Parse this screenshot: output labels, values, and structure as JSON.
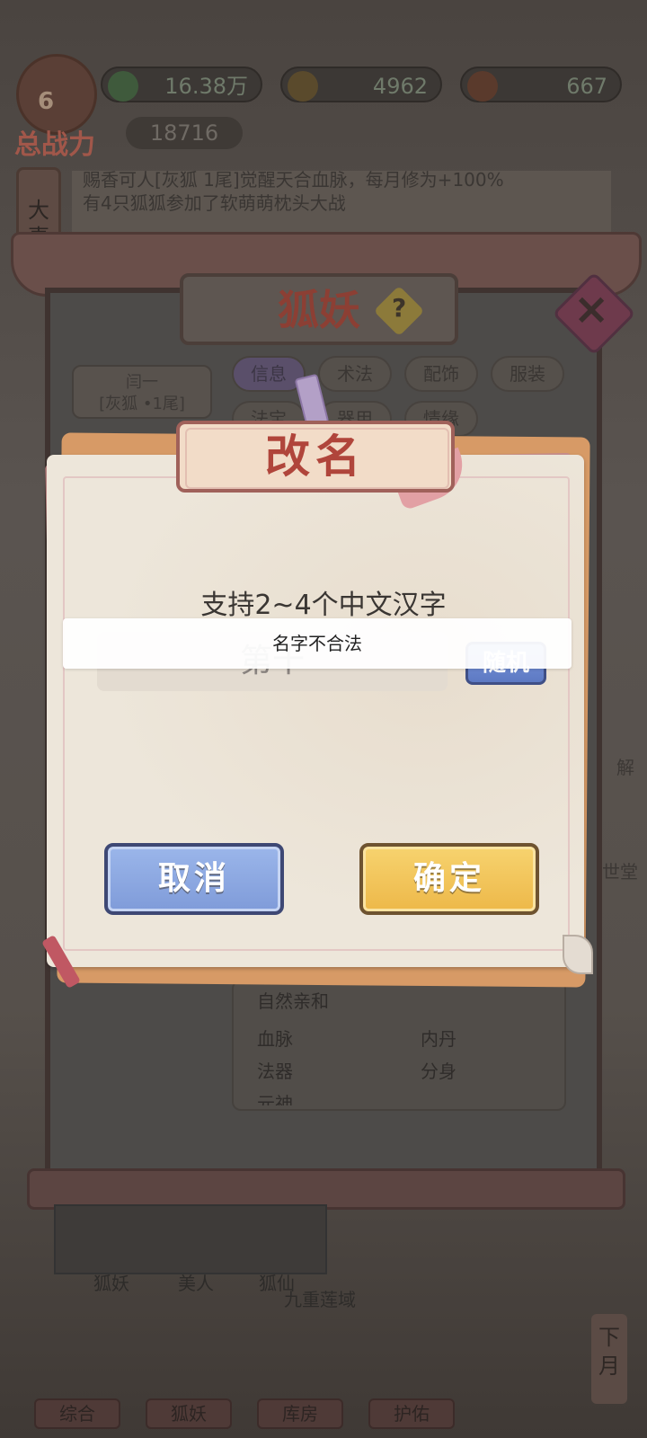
{
  "header": {
    "resources": [
      {
        "icon": "jade-gem-icon",
        "value": "16.38万",
        "color": "#4fa05a"
      },
      {
        "icon": "gold-coin-icon",
        "value": "4962",
        "color": "#d7a43a"
      },
      {
        "icon": "peach-icon",
        "value": "667",
        "color": "#d05a3a"
      }
    ],
    "power_label": "总战力",
    "power_level": "6",
    "power_value": "18716"
  },
  "events": {
    "label": "大事",
    "lines": [
      "赐香可人[灰狐 1尾]觉醒天合血脉，每月修为+100%",
      "有4只狐狐参加了软萌萌枕头大战"
    ]
  },
  "panel": {
    "title": "狐妖",
    "help_icon": "help-icon",
    "close_icon": "close-icon",
    "character_name": "闫一",
    "character_type": "[灰狐  •1尾]",
    "tabs": [
      "信息",
      "术法",
      "配饰",
      "服装",
      "法宝",
      "器用",
      "情缘"
    ],
    "info_header": "自然亲和",
    "info_rows": [
      [
        "血脉",
        "内丹"
      ],
      [
        "法器",
        "分身"
      ],
      [
        "元神",
        ""
      ]
    ],
    "side_labels": [
      "解",
      "世堂"
    ]
  },
  "sub_nav": [
    "狐妖",
    "美人",
    "狐仙"
  ],
  "region": "九重莲域",
  "next_month": "下月",
  "main_nav": [
    "综合",
    "狐妖",
    "库房",
    "护佑"
  ],
  "dialog": {
    "title": "改名",
    "hint": "支持2~4个中文汉字",
    "input_value": "第十",
    "random_label": "随机",
    "cancel_label": "取消",
    "confirm_label": "确定",
    "toast": "名字不合法"
  }
}
